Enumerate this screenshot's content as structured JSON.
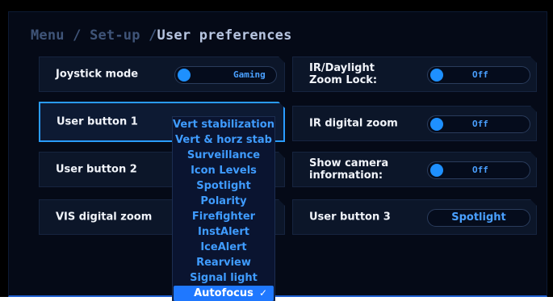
{
  "breadcrumb": {
    "menu": "Menu",
    "sep1": " / ",
    "setup": "Set-up",
    "sep2": " /",
    "current": "User preferences"
  },
  "left_tiles": [
    {
      "label": "Joystick mode",
      "control": "toggle",
      "value": "Gaming",
      "on": true
    },
    {
      "label": "User button 1",
      "control": "dropdown"
    },
    {
      "label": "User button 2"
    },
    {
      "label": "VIS digital zoom"
    }
  ],
  "right_tiles": [
    {
      "label_line1": "IR/Daylight",
      "label_line2": "Zoom Lock:",
      "control": "toggle",
      "value": "Off",
      "on": true
    },
    {
      "label": "IR digital zoom",
      "control": "toggle",
      "value": "Off",
      "on": true
    },
    {
      "label_line1": "Show camera",
      "label_line2": "information:",
      "control": "toggle",
      "value": "Off",
      "on": true
    },
    {
      "label": "User button 3",
      "control": "pill",
      "value": "Spotlight"
    }
  ],
  "dropdown": {
    "options": [
      "Vert stabilization",
      "Vert & horz stab",
      "Surveillance",
      "Icon Levels",
      "Spotlight",
      "Polarity",
      "Firefighter",
      "InstAlert",
      "IceAlert",
      "Rearview",
      "Signal light",
      "Autofocus"
    ],
    "selected": "Autofocus",
    "check_icon": "✓"
  },
  "colors": {
    "accent": "#1e90ff",
    "active_border": "#2a9cff",
    "selected_bg": "#1f78ff",
    "panel": "#050a17",
    "tile": "#0c1629"
  }
}
